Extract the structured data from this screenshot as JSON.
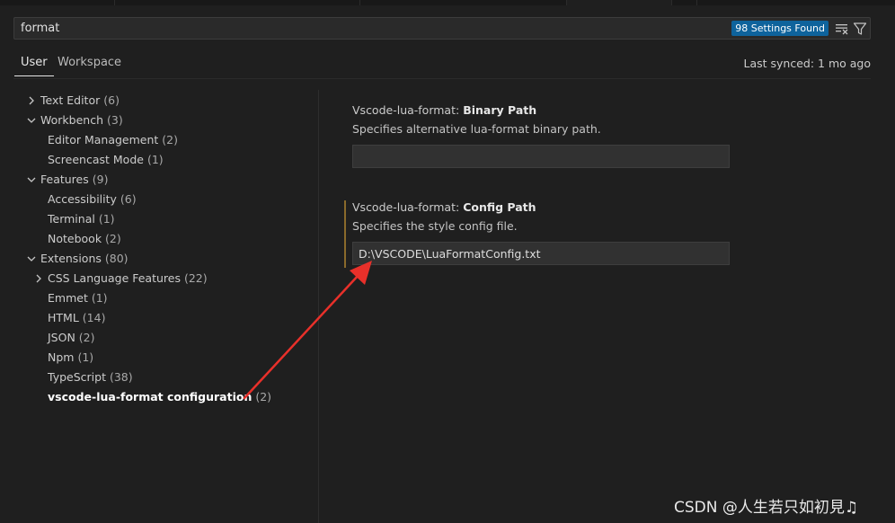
{
  "search": {
    "value": "format",
    "badge": "98 Settings Found"
  },
  "scope": {
    "tabs": [
      "User",
      "Workspace"
    ],
    "last_synced": "Last synced: 1 mo ago"
  },
  "tree": [
    {
      "label": "Text Editor",
      "count": "(6)",
      "chevron": "right",
      "level": 0
    },
    {
      "label": "Workbench",
      "count": "(3)",
      "chevron": "down",
      "level": 0
    },
    {
      "label": "Editor Management",
      "count": "(2)",
      "chevron": "",
      "level": 1
    },
    {
      "label": "Screencast Mode",
      "count": "(1)",
      "chevron": "",
      "level": 1
    },
    {
      "label": "Features",
      "count": "(9)",
      "chevron": "down",
      "level": 0
    },
    {
      "label": "Accessibility",
      "count": "(6)",
      "chevron": "",
      "level": 1
    },
    {
      "label": "Terminal",
      "count": "(1)",
      "chevron": "",
      "level": 1
    },
    {
      "label": "Notebook",
      "count": "(2)",
      "chevron": "",
      "level": 1
    },
    {
      "label": "Extensions",
      "count": "(80)",
      "chevron": "down",
      "level": 0
    },
    {
      "label": "CSS Language Features",
      "count": "(22)",
      "chevron": "right",
      "level": 1
    },
    {
      "label": "Emmet",
      "count": "(1)",
      "chevron": "",
      "level": 1
    },
    {
      "label": "HTML",
      "count": "(14)",
      "chevron": "",
      "level": 1
    },
    {
      "label": "JSON",
      "count": "(2)",
      "chevron": "",
      "level": 1
    },
    {
      "label": "Npm",
      "count": "(1)",
      "chevron": "",
      "level": 1
    },
    {
      "label": "TypeScript",
      "count": "(38)",
      "chevron": "",
      "level": 1
    },
    {
      "label": "vscode-lua-format configuration",
      "count": "(2)",
      "chevron": "",
      "level": 1,
      "bold": true
    }
  ],
  "settings": {
    "binary": {
      "prefix": "Vscode-lua-format: ",
      "name": "Binary Path",
      "desc": "Specifies alternative lua-format binary path.",
      "value": ""
    },
    "config": {
      "prefix": "Vscode-lua-format: ",
      "name": "Config Path",
      "desc": "Specifies the style config file.",
      "value": "D:\\VSCODE\\LuaFormatConfig.txt"
    }
  },
  "watermark": "CSDN @人生若只如初見♫",
  "colors": {
    "badge": "#0e639c",
    "annotation_arrow": "#e8302a",
    "modified_indicator": "#8a6a2b"
  },
  "icons": {
    "clear_filter": "clear-filter-icon",
    "filter": "filter-icon"
  }
}
